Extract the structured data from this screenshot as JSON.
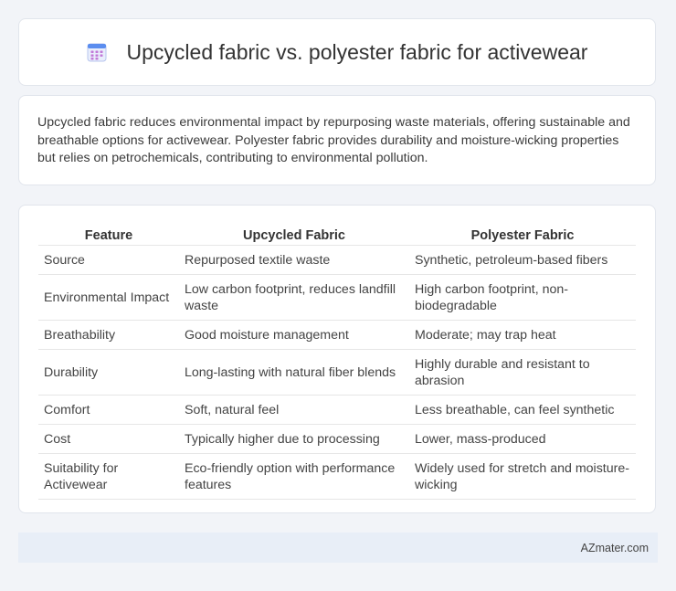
{
  "header": {
    "title": "Upcycled fabric vs. polyester fabric for activewear",
    "icon": "calendar-icon"
  },
  "intro": "Upcycled fabric reduces environmental impact by repurposing waste materials, offering sustainable and breathable options for activewear. Polyester fabric provides durability and moisture-wicking properties but relies on petrochemicals, contributing to environmental pollution.",
  "table": {
    "headers": [
      "Feature",
      "Upcycled Fabric",
      "Polyester Fabric"
    ],
    "rows": [
      [
        "Source",
        "Repurposed textile waste",
        "Synthetic, petroleum-based fibers"
      ],
      [
        "Environmental Impact",
        "Low carbon footprint, reduces landfill waste",
        "High carbon footprint, non-biodegradable"
      ],
      [
        "Breathability",
        "Good moisture management",
        "Moderate; may trap heat"
      ],
      [
        "Durability",
        "Long-lasting with natural fiber blends",
        "Highly durable and resistant to abrasion"
      ],
      [
        "Comfort",
        "Soft, natural feel",
        "Less breathable, can feel synthetic"
      ],
      [
        "Cost",
        "Typically higher due to processing",
        "Lower, mass-produced"
      ],
      [
        "Suitability for Activewear",
        "Eco-friendly option with performance features",
        "Widely used for stretch and moisture-wicking"
      ]
    ]
  },
  "footer": {
    "brand": "AZmater.com"
  },
  "colors": {
    "background": "#f2f4f8",
    "card": "#ffffff",
    "footer": "#e8eef7",
    "icon_accent": "#5b8def"
  }
}
